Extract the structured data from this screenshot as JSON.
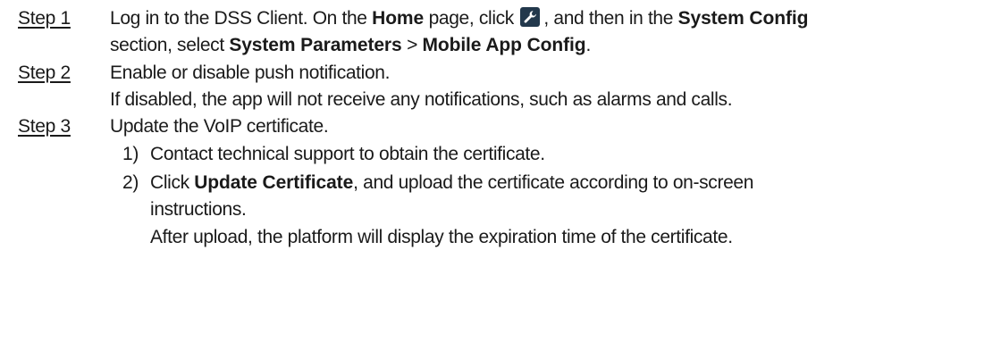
{
  "steps": [
    {
      "label": "Step 1",
      "lines": [
        {
          "p1": "Log in to the DSS Client. On the ",
          "b1": "Home",
          "p2": " page, click ",
          "icon": "wrench-icon",
          "p3": ", and then in the ",
          "b2": "System Config"
        },
        {
          "p1": "section, select ",
          "b1": "System Parameters",
          "p2": " > ",
          "b2": "Mobile App Config",
          "p3": "."
        }
      ]
    },
    {
      "label": "Step 2",
      "lines": [
        "Enable or disable push notification.",
        "If disabled, the app will not receive any notifications, such as alarms and calls."
      ]
    },
    {
      "label": "Step 3",
      "lines": [
        "Update the VoIP certificate."
      ],
      "substeps": [
        {
          "num": "1)",
          "text": "Contact technical support to obtain the certificate."
        },
        {
          "num": "2)",
          "p1": "Click ",
          "b1": "Update Certificate",
          "p2": ", and upload the certificate according to on-screen",
          "cont": "instructions.",
          "note": "After upload, the platform will display the expiration time of the certificate."
        }
      ]
    }
  ],
  "colors": {
    "text": "#1a1a1a",
    "icon_bg": "#22384c",
    "icon_fg": "#ffffff"
  }
}
